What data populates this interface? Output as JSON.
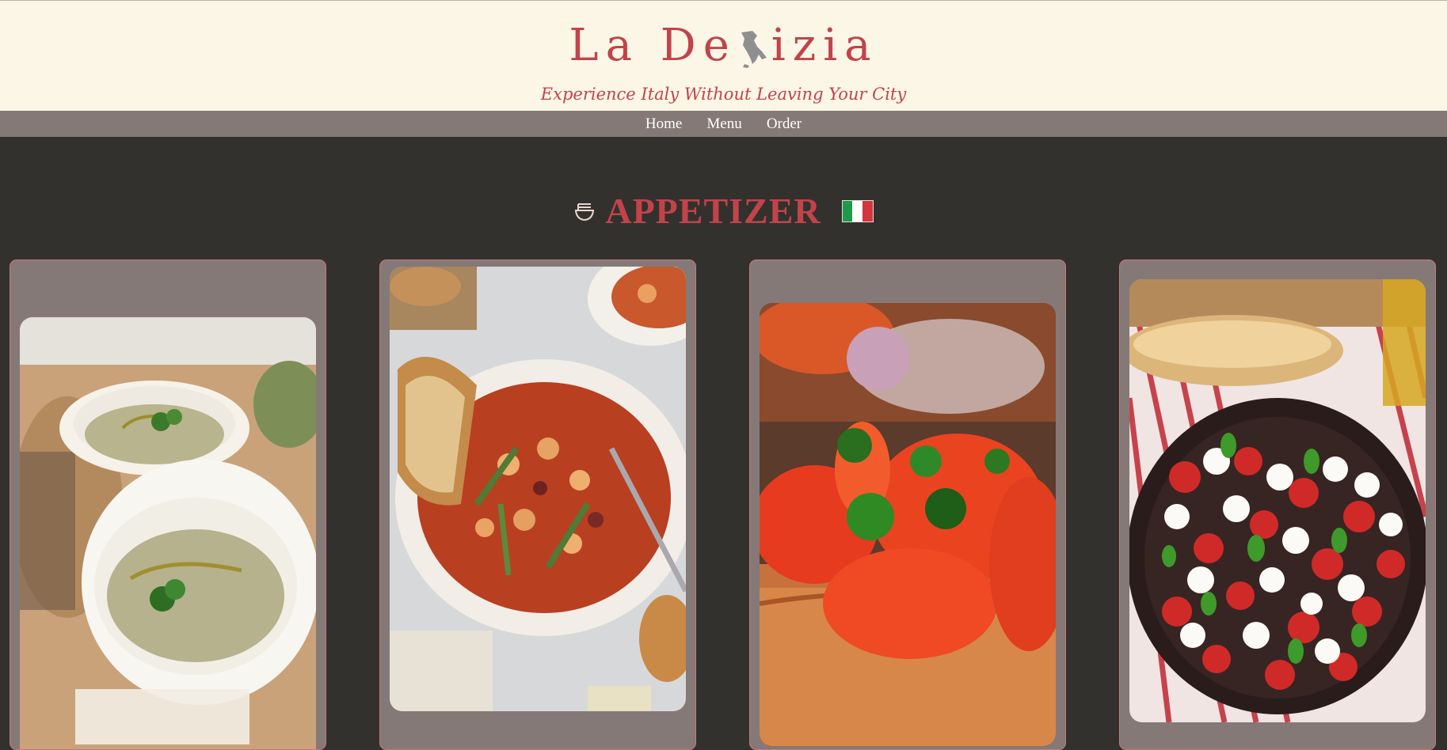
{
  "brand": {
    "logo_left": "La De",
    "logo_right": "izia",
    "tagline": "Experience Italy Without Leaving Your City"
  },
  "nav": {
    "items": [
      "Home",
      "Menu",
      "Order"
    ]
  },
  "section": {
    "title": "APPETIZER",
    "icon": "noodle-bowl-icon",
    "flag": "italy-flag-icon"
  },
  "cards": [
    {
      "photo": "artichoke-soup-bowls"
    },
    {
      "photo": "minestrone-soup-bowl"
    },
    {
      "photo": "tomato-bruschetta"
    },
    {
      "photo": "caprese-salad-skillet"
    }
  ],
  "colors": {
    "accent": "#c2434a",
    "header_bg": "#fbf6e6",
    "nav_bg": "#857977",
    "page_bg": "#33312e"
  }
}
